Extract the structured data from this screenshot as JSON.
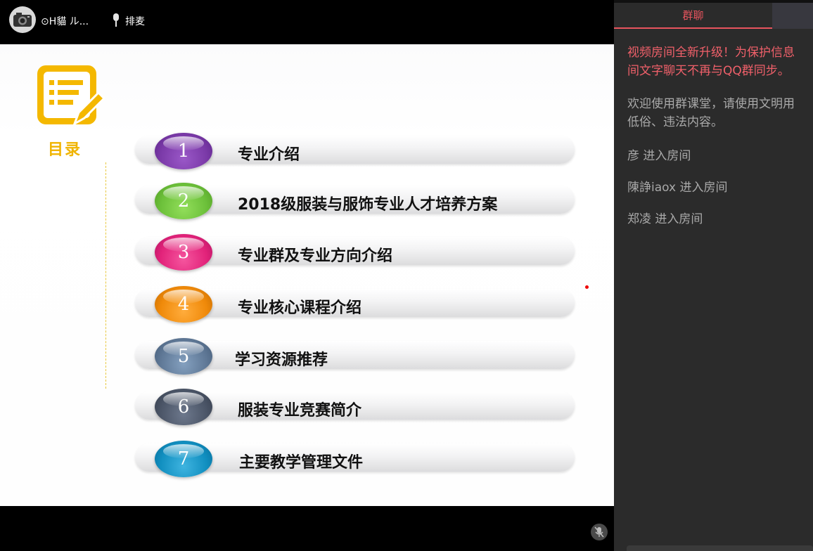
{
  "header": {
    "username": "⊙H貓 ル...",
    "queue_label": "排麦"
  },
  "slide": {
    "toc_title": "目录",
    "items": [
      {
        "num": "1",
        "label": "专业介绍",
        "color": "#7b3aa8"
      },
      {
        "num": "2",
        "label": "2018级服装与服饰专业人才培养方案",
        "color": "#6cc03a"
      },
      {
        "num": "3",
        "label": "专业群及专业方向介绍",
        "color": "#e2237a"
      },
      {
        "num": "4",
        "label": "专业核心课程介绍",
        "color": "#f08a0a"
      },
      {
        "num": "5",
        "label": "学习资源推荐",
        "color": "#5f7896"
      },
      {
        "num": "6",
        "label": "服装专业竞赛简介",
        "color": "#4b5567"
      },
      {
        "num": "7",
        "label": "主要教学管理文件",
        "color": "#118fc0"
      }
    ]
  },
  "chat": {
    "tab_label": "群聊",
    "messages": [
      {
        "type": "notice",
        "lines": [
          "视频房间全新升级！为保护信息",
          "间文字聊天不再与QQ群同步。"
        ]
      },
      {
        "type": "info",
        "lines": [
          "欢迎使用群课堂，请使用文明用",
          "低俗、违法内容。"
        ]
      },
      {
        "type": "info",
        "lines": [
          "彦 进入房间"
        ]
      },
      {
        "type": "info",
        "lines": [
          "陳諍iaox 进入房间"
        ]
      },
      {
        "type": "info",
        "lines": [
          "郑凌 进入房间"
        ]
      }
    ]
  },
  "colors": {
    "accent": "#e8545e",
    "toc_gold": "#f0b400",
    "chat_bg": "#2b2b2b"
  }
}
